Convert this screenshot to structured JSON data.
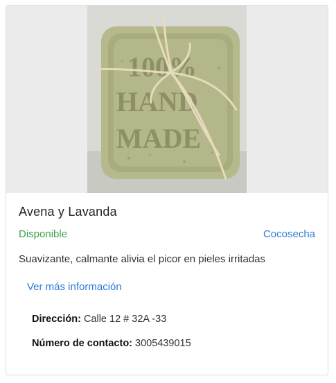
{
  "product": {
    "image_alt_icon": "soap-photo",
    "stamp_text": "100% HAND MADE",
    "title": "Avena y Lavanda",
    "status": "Disponible",
    "tag": "Cocosecha",
    "description": "Suavizante, calmante alivia el picor en pieles irritadas",
    "more_link": "Ver más información",
    "address_label": "Dirección:",
    "address_value": "Calle 12 # 32A -33",
    "phone_label": "Número de contacto:",
    "phone_value": "3005439015"
  },
  "colors": {
    "status": "#3aa34a",
    "link": "#2f7bd8",
    "soap": "#b9bb8d",
    "twine": "#e3d6b5"
  }
}
